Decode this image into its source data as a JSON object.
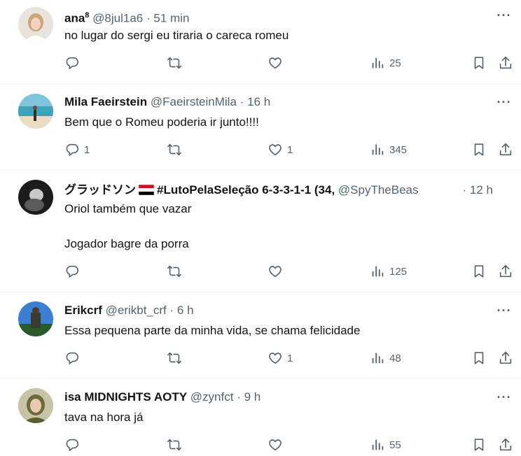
{
  "tweets": [
    {
      "name": "ana",
      "name_sup": "8",
      "handle": "@8jul1a6",
      "separator": "·",
      "time": "51 min",
      "text": [
        "no lugar do sergi eu tiraria o careca romeu"
      ],
      "replies": "",
      "likes": "",
      "views": "25"
    },
    {
      "name": "Mila Faeirstein",
      "handle": "@FaeirsteinMila",
      "separator": "·",
      "time": "16 h",
      "text": [
        "Bem que o Romeu poderia ir junto!!!!"
      ],
      "replies": "1",
      "likes": "1",
      "views": "345"
    },
    {
      "name_prefix": "グラッドソン",
      "name_suffix": "#LutoPelaSeleção 6-3-3-1-1 (34,",
      "handle": "@SpyTheBeas",
      "separator": "·",
      "time": "12 h",
      "text": [
        "Oriol também que vazar",
        "Jogador bagre da porra"
      ],
      "replies": "",
      "likes": "",
      "views": "125"
    },
    {
      "name": "Erikcrf",
      "handle": "@erikbt_crf",
      "separator": "·",
      "time": "6 h",
      "text": [
        "Essa pequena parte da minha vida, se chama felicidade"
      ],
      "replies": "",
      "likes": "1",
      "views": "48"
    },
    {
      "name": "isa MIDNIGHTS AOTY",
      "handle": "@zynfct",
      "separator": "·",
      "time": "9 h",
      "text": [
        "tava na hora já"
      ],
      "replies": "",
      "likes": "",
      "views": "55"
    }
  ],
  "more_glyph": "···",
  "colors": {
    "text": "#0f1419",
    "secondary": "#536471",
    "divider": "#eff3f4"
  },
  "icons": [
    "reply-icon",
    "repost-icon",
    "like-icon",
    "views-icon",
    "bookmark-icon",
    "share-icon",
    "more-icon",
    "flag-icon"
  ]
}
